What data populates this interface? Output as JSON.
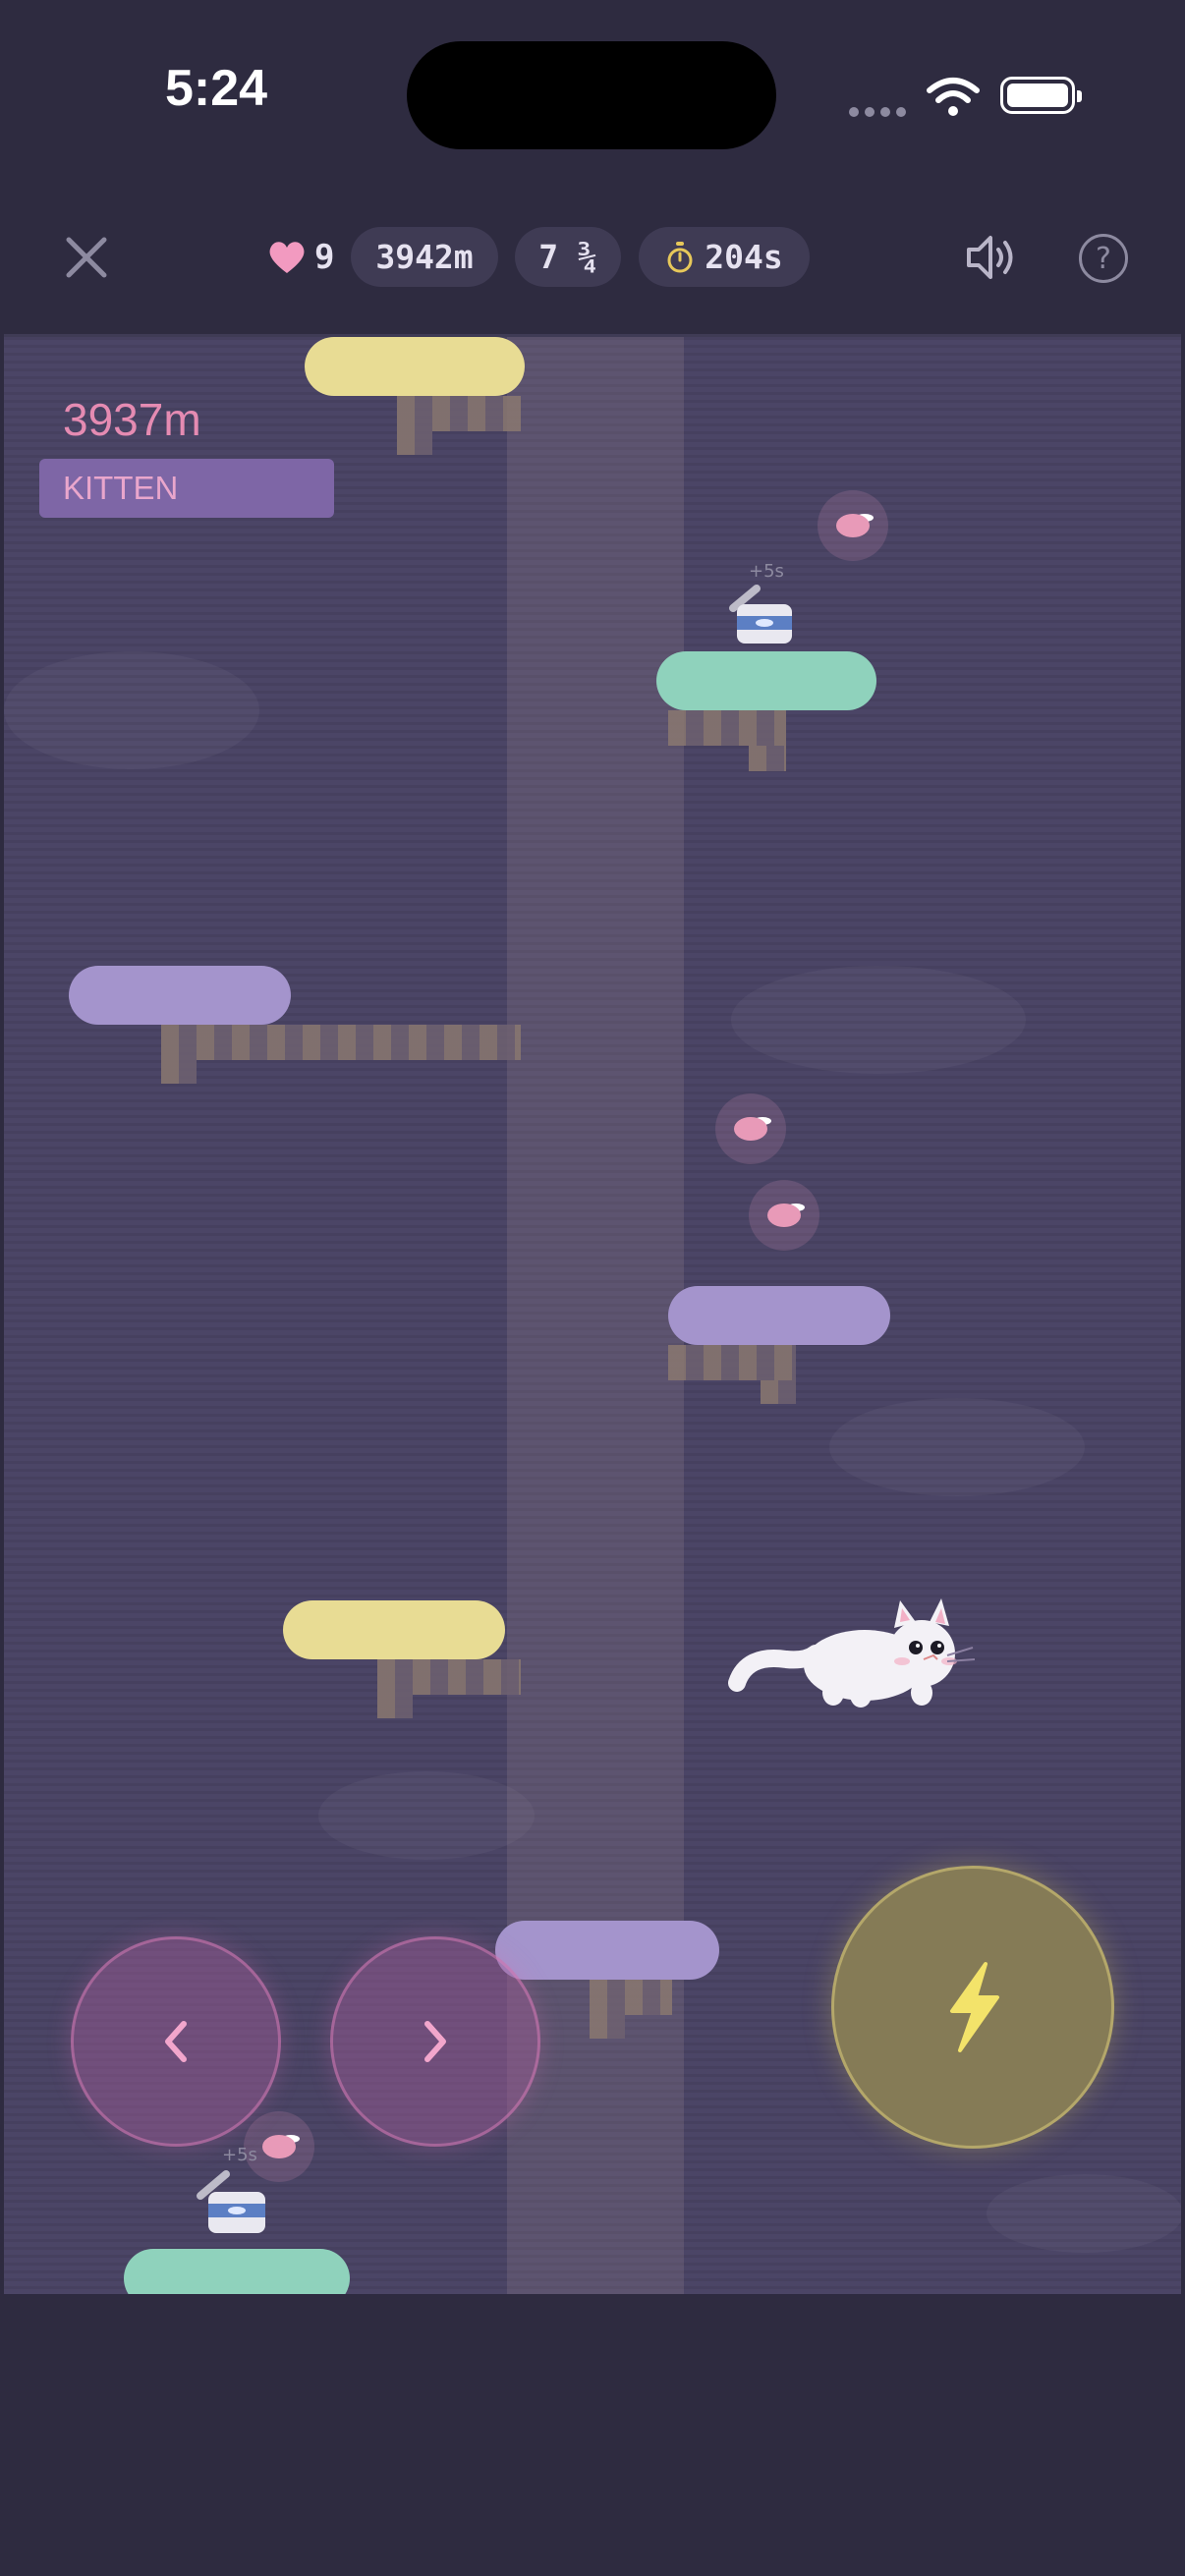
{
  "status_bar": {
    "time": "5:24"
  },
  "top_bar": {
    "lives": "9",
    "height": "3942m",
    "level": "7 ¾",
    "timer": "204s"
  },
  "game": {
    "current_height": "3937m",
    "rank": "KITTEN",
    "pickups": {
      "can_bonus": "+5s"
    }
  },
  "colors": {
    "background": "#2e2b40",
    "heart": "#f29ac0",
    "timer_icon": "#e7c85a",
    "bolt": "#f3e36a",
    "platform_yellow": "#e8dc94",
    "platform_mint": "#8fd2bc",
    "platform_lilac": "#a494cc"
  },
  "icons": [
    "close-icon",
    "heart-icon",
    "stopwatch-icon",
    "speaker-icon",
    "help-icon",
    "chevron-left-icon",
    "chevron-right-icon",
    "lightning-icon",
    "fish-icon",
    "tuna-can-icon",
    "cat-icon"
  ]
}
